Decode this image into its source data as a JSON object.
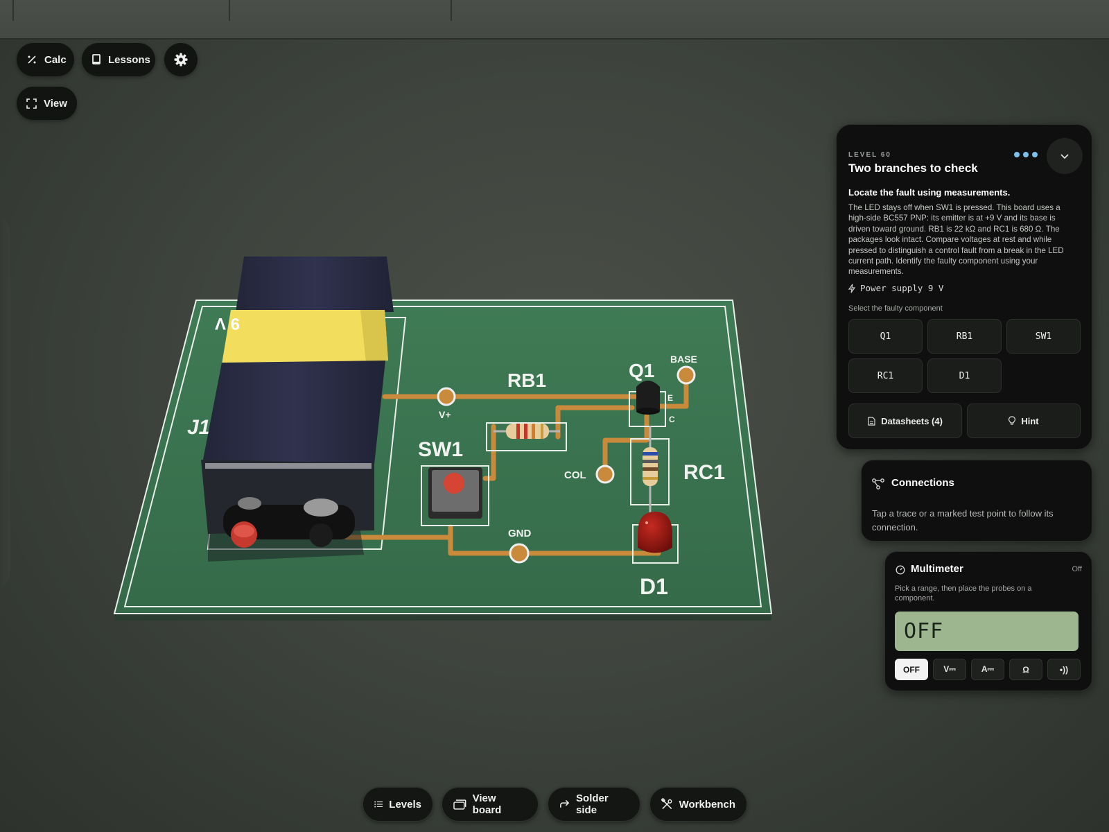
{
  "toolbar": {
    "calc_label": "Calc",
    "lessons_label": "Lessons",
    "view_label": "View"
  },
  "board": {
    "battery_label": "9 V",
    "labels": {
      "j1": "J1",
      "rb1": "RB1",
      "q1": "Q1",
      "base": "BASE",
      "e": "E",
      "c": "C",
      "vplus": "V+",
      "sw1": "SW1",
      "col": "COL",
      "rc1": "RC1",
      "gnd": "GND",
      "d1": "D1"
    }
  },
  "level_panel": {
    "level": "LEVEL 60",
    "title": "Two branches to check",
    "task_heading": "Locate the fault using measurements.",
    "description": "The LED stays off when SW1 is pressed. This board uses a high-side BC557 PNP: its emitter is at +9 V and its base is driven toward ground. RB1 is 22 kΩ and RC1 is 680 Ω. The packages look intact. Compare voltages at rest and while pressed to distinguish a control fault from a break in the LED current path. Identify the faulty component using your measurements.",
    "power": "Power supply 9 V",
    "select_label": "Select the faulty component",
    "components": [
      "Q1",
      "RB1",
      "SW1",
      "RC1",
      "D1"
    ],
    "datasheets_label": "Datasheets (4)",
    "hint_label": "Hint"
  },
  "connections": {
    "title": "Connections",
    "description": "Tap a trace or a marked test point to follow its connection."
  },
  "multimeter": {
    "title": "Multimeter",
    "state": "Off",
    "description": "Pick a range, then place the probes on a component.",
    "display": "OFF",
    "modes": [
      "OFF",
      "V⎓",
      "A⎓",
      "Ω",
      "•))"
    ],
    "active_mode": "OFF"
  },
  "bottom_bar": {
    "levels_label": "Levels",
    "view_board_label": "View board",
    "solder_side_label": "Solder side",
    "workbench_label": "Workbench"
  },
  "colors": {
    "board": "#3f7a55",
    "trace": "#c98a3c",
    "battery_body": "#2e3048",
    "battery_band": "#f2dd5c",
    "multimeter_display": "#9db690",
    "accent_dots": "#7ec0ee"
  }
}
